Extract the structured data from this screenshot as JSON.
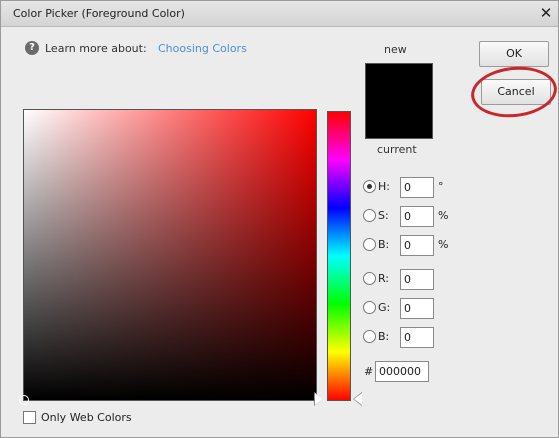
{
  "window": {
    "title": "Color Picker (Foreground Color)",
    "close_glyph": "✕"
  },
  "help": {
    "icon_glyph": "?",
    "text": "Learn more about:",
    "link": "Choosing Colors"
  },
  "preview": {
    "new_label": "new",
    "current_label": "current",
    "new_color": "#000000",
    "current_color": "#000000"
  },
  "buttons": {
    "ok": "OK",
    "cancel": "Cancel"
  },
  "fields": {
    "h": {
      "label": "H:",
      "value": "0",
      "unit": "°",
      "checked": true
    },
    "s": {
      "label": "S:",
      "value": "0",
      "unit": "%"
    },
    "b": {
      "label": "B:",
      "value": "0",
      "unit": "%"
    },
    "r": {
      "label": "R:",
      "value": "0"
    },
    "g": {
      "label": "G:",
      "value": "0"
    },
    "b2": {
      "label": "B:",
      "value": "0"
    },
    "hex": {
      "prefix": "#",
      "value": "000000"
    }
  },
  "web_colors": {
    "label": "Only Web Colors",
    "checked": false
  },
  "colors": {
    "highlight_ring": "#c8282c",
    "link": "#4a8fd0",
    "hue": "#ff0000"
  }
}
